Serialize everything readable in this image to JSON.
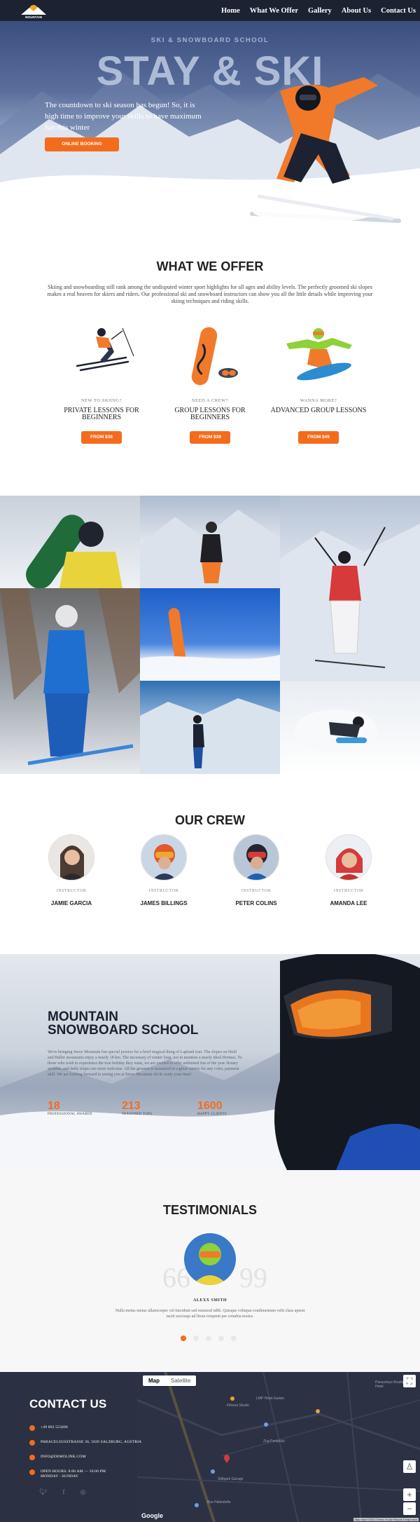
{
  "nav": {
    "logo_text": "MOUNTAIN",
    "items": [
      "Home",
      "What We Offer",
      "Gallery",
      "About Us",
      "Contact Us"
    ]
  },
  "hero": {
    "kicker": "SKI & SNOWBOARD SCHOOL",
    "title": "STAY & SKI",
    "text": "The countdown to ski season has begun! So, it is high time to improve your skills to have maximum fun this winter",
    "button": "ONLINE BOOKING"
  },
  "offer": {
    "title": "WHAT WE OFFER",
    "description": "Skiing and snowboarding still rank among the undisputed winter sport highlights for all ages and ability levels. The perfectly groomed ski slopes makes a real heaven for skiers and riders. Our professional ski and snowboard instructors can show you all the little details while improving your skiing techniques and riding skills.",
    "cards": [
      {
        "kicker": "NEW TO SKIING?",
        "name": "PRIVATE LESSONS FOR BEGINNERS",
        "button": "FROM $39",
        "icon": "skier-icon"
      },
      {
        "kicker": "NEED A CREW?",
        "name": "GROUP LESSONS FOR BEGINNERS",
        "button": "FROM $39",
        "icon": "snowboard-icon"
      },
      {
        "kicker": "WANNA MORE?",
        "name": "ADVANCED GROUP LESSONS",
        "button": "FROM $49",
        "icon": "snowboarder-icon"
      }
    ]
  },
  "crew": {
    "title": "OUR CREW",
    "members": [
      {
        "role": "INSTRUCTOR",
        "name": "JAMIE GARCIA"
      },
      {
        "role": "INSTRUCTOR",
        "name": "JAMES BILLINGS"
      },
      {
        "role": "INSTRUCTOR",
        "name": "PETER COLINS"
      },
      {
        "role": "INSTRUCTOR",
        "name": "AMANDA LEE"
      }
    ]
  },
  "school": {
    "title_line1": "MOUNTAIN",
    "title_line2": "SNOWBOARD SCHOOL",
    "text": "We're bringing Snow Mountain fun special powers for a brief magical thing of Lapland tour. The slopes on Hold and Haller mountains enjoy a nearly 18 km. The necessary of winter long, not to mention a nearly ideal Hermes. To those who wish to experience the true holiday they want, we are excited to offer unlimited fun of the year. Rotary systems, and daily slopes are more welcome. All the greatest is measured in a great variety for any color, payment skill. We are looking forward to seeing you at Snow Mountain ski & ready your time!",
    "stats": [
      {
        "num": "18",
        "label": "PROFESSIONAL AWARDS"
      },
      {
        "num": "213",
        "label": "SEASONED TOPS"
      },
      {
        "num": "1600",
        "label": "HAPPY CLIENTS"
      }
    ]
  },
  "testimonials": {
    "title": "TESTIMONIALS",
    "name": "ALEXX SMITH",
    "text": "Nulla metus metus ullamcorper vel tincidunt sed euismod nibh. Quisque volutpat condimentum velit class aptent taciti sociosqu ad litora torquent per conubia nostra.",
    "open_quote": "66",
    "close_quote": "99"
  },
  "contact": {
    "title": "CONTACT US",
    "phone": "+49 803 553496",
    "address": "PARACELSUSSTRASSE 36, 5020 SALZBURG, AUSTRIA",
    "email": "INFO@DEMOLINK.COM",
    "hours_line1": "OPEN HOURS: 8:00 AM — 10:00 PM",
    "hours_line2": "MONDAY - SUNDAY",
    "social": [
      "twitter-icon",
      "facebook-icon",
      "instagram-icon"
    ]
  },
  "map": {
    "tab_map": "Map",
    "tab_satellite": "Satellite",
    "labels": [
      "LMP Hotel-Garten",
      "Paracelsus Boutique Hotel",
      "Fitness Studio",
      "Zug Parkplatz",
      "Stiftpark Garage",
      "Bus Haltestelle"
    ],
    "zoom_in": "+",
    "zoom_out": "−",
    "brand": "Google",
    "footer": "Map data ©2021  Terms of Use  Report a map error"
  },
  "colors": {
    "accent": "#f36c1c",
    "dark": "#1d2233",
    "footer": "#2b3142"
  }
}
